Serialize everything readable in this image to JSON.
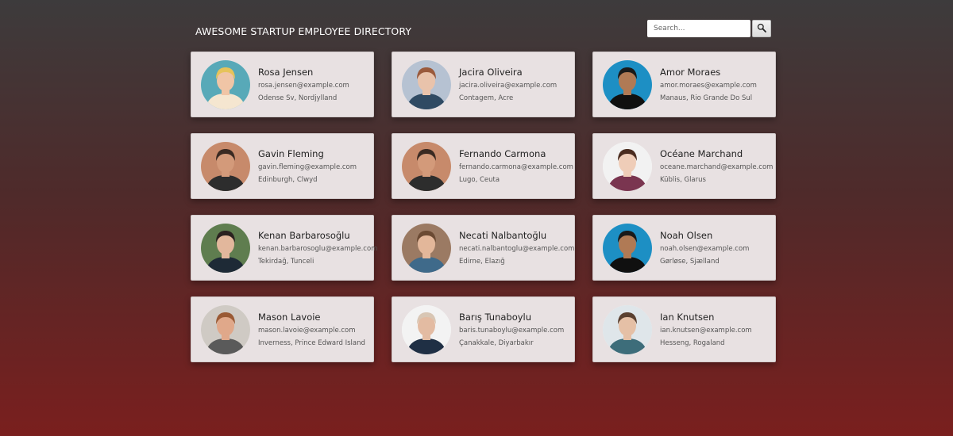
{
  "header": {
    "title": "AWESOME STARTUP EMPLOYEE DIRECTORY"
  },
  "search": {
    "placeholder": "Search...",
    "icon": "magnifier-icon"
  },
  "colors": {
    "background_top": "#3d3b3c",
    "background_bottom": "#7a1f1e",
    "card_background": "#e8e1e2"
  },
  "employees": [
    {
      "name": "Rosa Jensen",
      "email": "rosa.jensen@example.com",
      "location": "Odense Sv, Nordjylland",
      "avatar": {
        "bg": "#58a9b8",
        "skin": "#f0c5a6",
        "hair": "#e6c35a",
        "shirt": "#f5e6d0"
      }
    },
    {
      "name": "Jacira Oliveira",
      "email": "jacira.oliveira@example.com",
      "location": "Contagem, Acre",
      "avatar": {
        "bg": "#b6c2d2",
        "skin": "#e9c3ab",
        "hair": "#9a5a3c",
        "shirt": "#2f4a63"
      }
    },
    {
      "name": "Amor Moraes",
      "email": "amor.moraes@example.com",
      "location": "Manaus, Rio Grande Do Sul",
      "avatar": {
        "bg": "#1d8fc4",
        "skin": "#b07a55",
        "hair": "#1a1a1a",
        "shirt": "#101010"
      }
    },
    {
      "name": "Gavin Fleming",
      "email": "gavin.fleming@example.com",
      "location": "Edinburgh, Clwyd",
      "avatar": {
        "bg": "#c78a6b",
        "skin": "#d39a7a",
        "hair": "#3a2a22",
        "shirt": "#2d2d2d"
      }
    },
    {
      "name": "Fernando Carmona",
      "email": "fernando.carmona@example.com",
      "location": "Lugo, Ceuta",
      "avatar": {
        "bg": "#c78a6b",
        "skin": "#d39a7a",
        "hair": "#3a2a22",
        "shirt": "#2d2d2d"
      }
    },
    {
      "name": "Océane Marchand",
      "email": "oceane.marchand@example.com",
      "location": "Küblis, Glarus",
      "avatar": {
        "bg": "#f2f2f2",
        "skin": "#efcdb8",
        "hair": "#4a2c1f",
        "shirt": "#7a3550"
      }
    },
    {
      "name": "Kenan Barbarosoğlu",
      "email": "kenan.barbarosoglu@example.com",
      "location": "Tekirdağ, Tunceli",
      "avatar": {
        "bg": "#5f7d4f",
        "skin": "#e2b79c",
        "hair": "#2b2220",
        "shirt": "#1e2a36"
      }
    },
    {
      "name": "Necati Nalbantoğlu",
      "email": "necati.nalbantoglu@example.com",
      "location": "Edirne, Elazığ",
      "avatar": {
        "bg": "#9b7a63",
        "skin": "#e3b79a",
        "hair": "#6b4a33",
        "shirt": "#3f6a8a"
      }
    },
    {
      "name": "Noah Olsen",
      "email": "noah.olsen@example.com",
      "location": "Gørløse, Sjælland",
      "avatar": {
        "bg": "#1d8fc4",
        "skin": "#b07a55",
        "hair": "#1a1a1a",
        "shirt": "#101010"
      }
    },
    {
      "name": "Mason Lavoie",
      "email": "mason.lavoie@example.com",
      "location": "Inverness, Prince Edward Island",
      "avatar": {
        "bg": "#cfcac4",
        "skin": "#e0a88a",
        "hair": "#9a5a35",
        "shirt": "#5a5a5a"
      }
    },
    {
      "name": "Barış Tunaboylu",
      "email": "baris.tunaboylu@example.com",
      "location": "Çanakkale, Diyarbakır",
      "avatar": {
        "bg": "#f3f3f3",
        "skin": "#e3bba2",
        "hair": "#d8c6b4",
        "shirt": "#1f2f44"
      }
    },
    {
      "name": "Ian Knutsen",
      "email": "ian.knutsen@example.com",
      "location": "Hesseng, Rogaland",
      "avatar": {
        "bg": "#dfe6ea",
        "skin": "#e5c0a6",
        "hair": "#5a4030",
        "shirt": "#3d6d7a"
      }
    }
  ]
}
